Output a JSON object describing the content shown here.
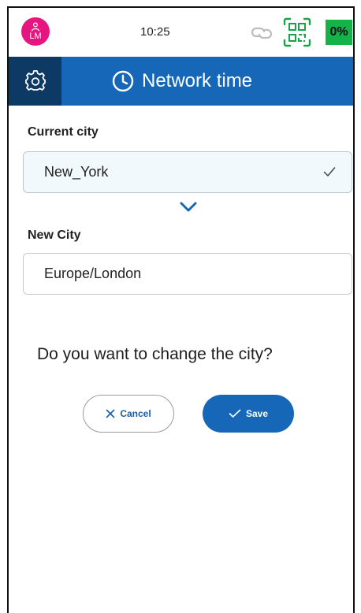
{
  "status": {
    "avatar_initials": "LM",
    "time": "10:25",
    "battery": "0%",
    "battery_color": "#14b34a"
  },
  "header": {
    "title": "Network time",
    "bg_color": "#1667b8",
    "settings_bg_color": "#0d3a64"
  },
  "current_city": {
    "label": "Current city",
    "value": "New_York"
  },
  "new_city": {
    "label": "New City",
    "value": "Europe/London"
  },
  "question": "Do you want to change the city?",
  "actions": {
    "cancel_label": "Cancel",
    "save_label": "Save"
  },
  "icons": [
    "user-icon",
    "link-icon",
    "qr-code-icon",
    "gear-icon",
    "clock-icon",
    "check-icon",
    "chevron-down-icon",
    "close-icon"
  ]
}
